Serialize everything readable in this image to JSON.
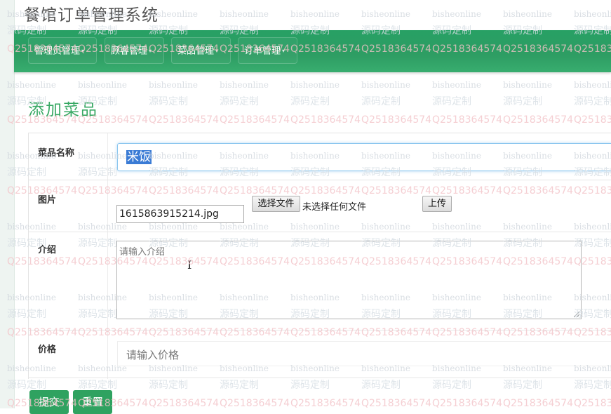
{
  "app": {
    "title": "餐馆订单管理系统"
  },
  "nav": {
    "items": [
      {
        "label": "管理员管理"
      },
      {
        "label": "顾客管理"
      },
      {
        "label": "菜品管理"
      },
      {
        "label": "订单管理"
      }
    ]
  },
  "page": {
    "heading": "添加菜品"
  },
  "form": {
    "name_label": "菜品名称",
    "name_value": "米饭",
    "image_label": "图片",
    "image_path": "1615863915214.jpg",
    "choose_file_label": "选择文件",
    "no_file_text": "未选择任何文件",
    "upload_label": "上传",
    "intro_label": "介绍",
    "intro_placeholder": "请输入介绍",
    "price_label": "价格",
    "price_placeholder": "请输入价格",
    "submit_label": "提交",
    "reset_label": "重置"
  },
  "watermark": {
    "line1": "bisheonline",
    "line2": "源码定制",
    "line3": "Q2518364574",
    "colors": {
      "line1": "#cfd6dc",
      "line2": "#d6dde3",
      "line3": "#f3c3c8"
    }
  },
  "colors": {
    "navbar": "#2e9d63",
    "heading": "#37a863",
    "focus": "#66afe9"
  }
}
